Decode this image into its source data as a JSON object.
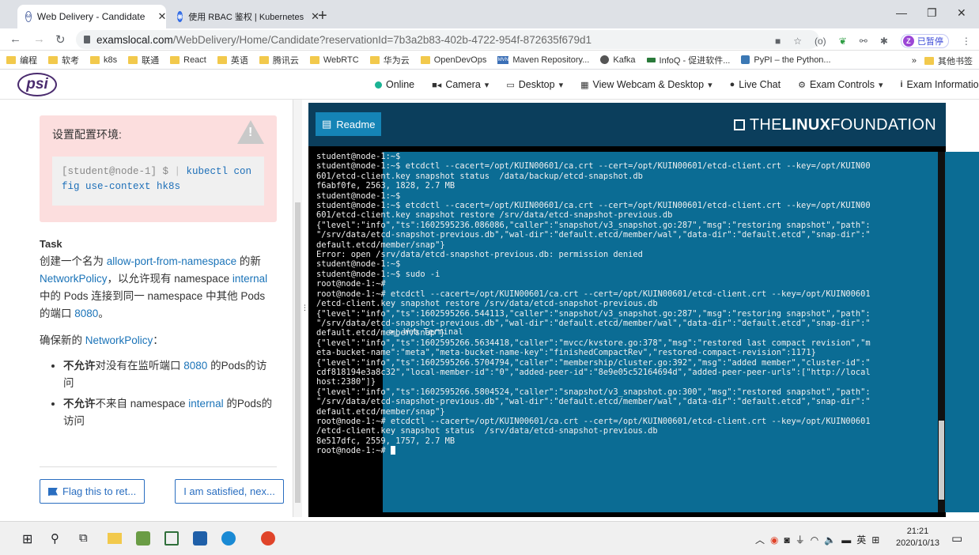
{
  "browser": {
    "tabs": [
      {
        "title": "Web Delivery - Candidate",
        "active": true
      },
      {
        "title": "使用 RBAC 鉴权 | Kubernetes",
        "active": false
      }
    ],
    "url_host": "examslocal.com",
    "url_rest": "/WebDelivery/Home/Candidate?reservationId=7b3a2b83-402b-4722-954f-872635f679d1",
    "paused_label": "已暂停",
    "profile_initial": "Z",
    "bookmarks": [
      "编程",
      "软考",
      "k8s",
      "联通",
      "React",
      "英语",
      "腾讯云",
      "WebRTC",
      "华为云",
      "OpenDevOps",
      "Maven Repository...",
      "Kafka",
      "InfoQ - 促进软件...",
      "PyPI – the Python..."
    ],
    "other_bookmarks": "其他书签",
    "more": "»"
  },
  "psi": {
    "logo": "psi",
    "nav": [
      "Online",
      "Camera",
      "Desktop",
      "View Webcam & Desktop",
      "Live Chat",
      "Exam Controls",
      "Exam Information"
    ]
  },
  "left": {
    "warning_title": "设置配置环境:",
    "code_prompt": "[student@node-1] $ ",
    "code_cmd": "kubectl config use-context hk8s",
    "task_heading": "Task",
    "task_p1_a": "创建一个名为 ",
    "task_p1_link1": "allow-port-from-namespace",
    "task_p1_b": " 的新 ",
    "task_p1_link2": "NetworkPolicy",
    "task_p1_c": "，以允许现有 namespace ",
    "task_p1_link3": "internal",
    "task_p1_d": " 中的 Pods 连接到同一 namespace 中其他 Pods 的端口 ",
    "task_p1_link4": "8080",
    "task_p1_e": "。",
    "ensure_a": "确保新的 ",
    "ensure_link": "NetworkPolicy",
    "ensure_b": "：",
    "bullet1_bold": "不允许",
    "bullet1_a": "对没有在监听端口 ",
    "bullet1_link": "8080",
    "bullet1_b": " 的Pods的访问",
    "bullet2_bold": "不允许",
    "bullet2_a": "不来自 namespace ",
    "bullet2_link": "internal",
    "bullet2_b": " 的Pods的访问",
    "flag_button": "Flag this to ret...",
    "satisfied_button": "I am satisfied, nex..."
  },
  "right": {
    "tab_readme": "Readme",
    "tab_terminal": "Web Terminal",
    "brand_prefix": "THE",
    "brand_bold": "LINUX",
    "brand_suffix": "FOUNDATION",
    "terminal_text": "student@node-1:~$\nstudent@node-1:~$ etcdctl --cacert=/opt/KUIN00601/ca.crt --cert=/opt/KUIN00601/etcd-client.crt --key=/opt/KUIN00\n601/etcd-client.key snapshot status  /data/backup/etcd-snapshot.db\nf6abf0fe, 2563, 1828, 2.7 MB\nstudent@node-1:~$\nstudent@node-1:~$ etcdctl --cacert=/opt/KUIN00601/ca.crt --cert=/opt/KUIN00601/etcd-client.crt --key=/opt/KUIN00\n601/etcd-client.key snapshot restore /srv/data/etcd-snapshot-previous.db\n{\"level\":\"info\",\"ts\":1602595236.086086,\"caller\":\"snapshot/v3_snapshot.go:287\",\"msg\":\"restoring snapshot\",\"path\":\n\"/srv/data/etcd-snapshot-previous.db\",\"wal-dir\":\"default.etcd/member/wal\",\"data-dir\":\"default.etcd\",\"snap-dir\":\"\ndefault.etcd/member/snap\"}\nError: open /srv/data/etcd-snapshot-previous.db: permission denied\nstudent@node-1:~$\nstudent@node-1:~$ sudo -i\nroot@node-1:~#\nroot@node-1:~# etcdctl --cacert=/opt/KUIN00601/ca.crt --cert=/opt/KUIN00601/etcd-client.crt --key=/opt/KUIN00601\n/etcd-client.key snapshot restore /srv/data/etcd-snapshot-previous.db\n{\"level\":\"info\",\"ts\":1602595266.544113,\"caller\":\"snapshot/v3_snapshot.go:287\",\"msg\":\"restoring snapshot\",\"path\":\n\"/srv/data/etcd-snapshot-previous.db\",\"wal-dir\":\"default.etcd/member/wal\",\"data-dir\":\"default.etcd\",\"snap-dir\":\"\ndefault.etcd/member/snap\"}\n{\"level\":\"info\",\"ts\":1602595266.5634418,\"caller\":\"mvcc/kvstore.go:378\",\"msg\":\"restored last compact revision\",\"m\neta-bucket-name\":\"meta\",\"meta-bucket-name-key\":\"finishedCompactRev\",\"restored-compact-revision\":1171}\n{\"level\":\"info\",\"ts\":1602595266.5704794,\"caller\":\"membership/cluster.go:392\",\"msg\":\"added member\",\"cluster-id\":\"\ncdf818194e3a8c32\",\"local-member-id\":\"0\",\"added-peer-id\":\"8e9e05c52164694d\",\"added-peer-peer-urls\":[\"http://local\nhost:2380\"]}\n{\"level\":\"info\",\"ts\":1602595266.5804524,\"caller\":\"snapshot/v3_snapshot.go:300\",\"msg\":\"restored snapshot\",\"path\":\n\"/srv/data/etcd-snapshot-previous.db\",\"wal-dir\":\"default.etcd/member/wal\",\"data-dir\":\"default.etcd\",\"snap-dir\":\"\ndefault.etcd/member/snap\"}\nroot@node-1:~# etcdctl --cacert=/opt/KUIN00601/ca.crt --cert=/opt/KUIN00601/etcd-client.crt --key=/opt/KUIN00601\n/etcd-client.key snapshot status  /srv/data/etcd-snapshot-previous.db\n8e517dfc, 2559, 1757, 2.7 MB\n",
    "terminal_prompt": "root@node-1:~# "
  },
  "taskbar": {
    "ime": "英",
    "time": "21:21",
    "date": "2020/10/13"
  },
  "colors": {
    "accent_blue": "#1a73b8",
    "terminal_bg": "#000000",
    "linux_header": "#0b3e5c",
    "warning_bg": "#fcdede"
  }
}
